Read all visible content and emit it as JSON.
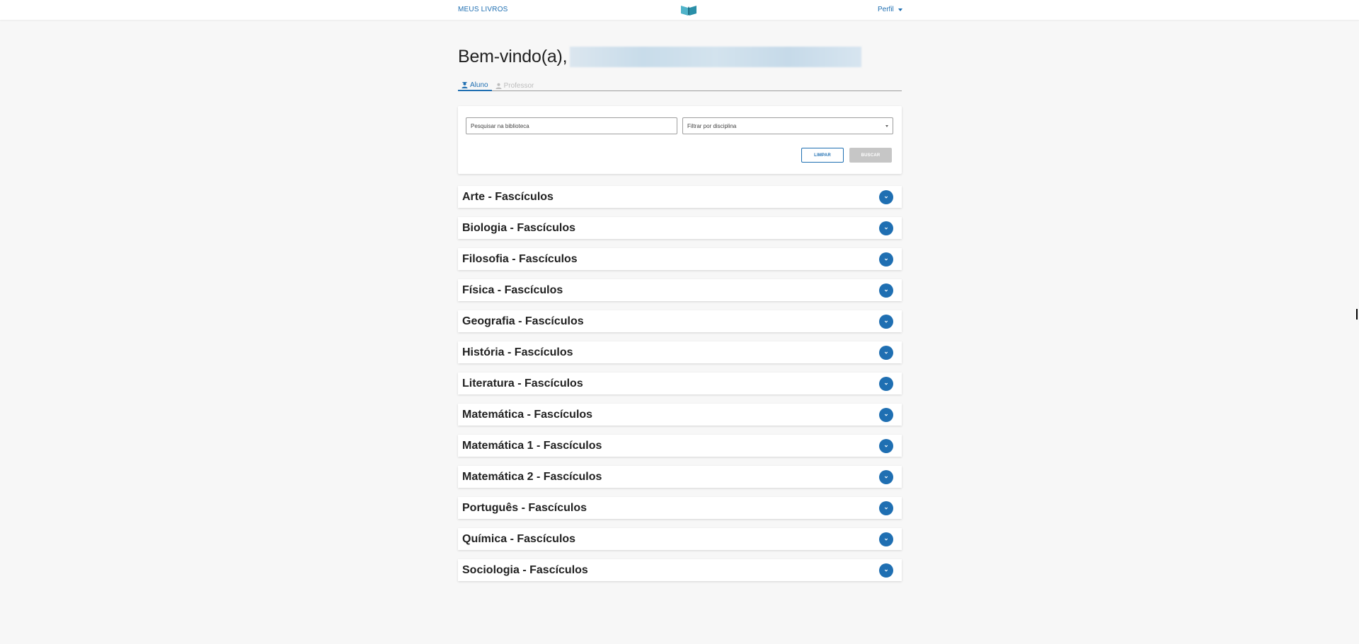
{
  "header": {
    "nav_label": "MEUS LIVROS",
    "logo_icon": "book-logo-icon",
    "profile_label": "Perfil",
    "accent_color": "#1f6fb2"
  },
  "welcome": {
    "greeting": "Bem-vindo(a),"
  },
  "tabs": [
    {
      "label": "Aluno",
      "icon": "student-icon",
      "active": true
    },
    {
      "label": "Professor",
      "icon": "teacher-icon",
      "active": false
    }
  ],
  "search": {
    "placeholder": "Pesquisar na biblioteca",
    "value": "",
    "filter_label": "Filtrar por disciplina",
    "clear_label": "LIMPAR",
    "search_label": "BUSCAR"
  },
  "subjects": [
    "Arte - Fascículos",
    "Biologia - Fascículos",
    "Filosofia - Fascículos",
    "Física - Fascículos",
    "Geografia - Fascículos",
    "História - Fascículos",
    "Literatura - Fascículos",
    "Matemática - Fascículos",
    "Matemática 1 - Fascículos",
    "Matemática 2 - Fascículos",
    "Português - Fascículos",
    "Química - Fascículos",
    "Sociologia - Fascículos"
  ]
}
